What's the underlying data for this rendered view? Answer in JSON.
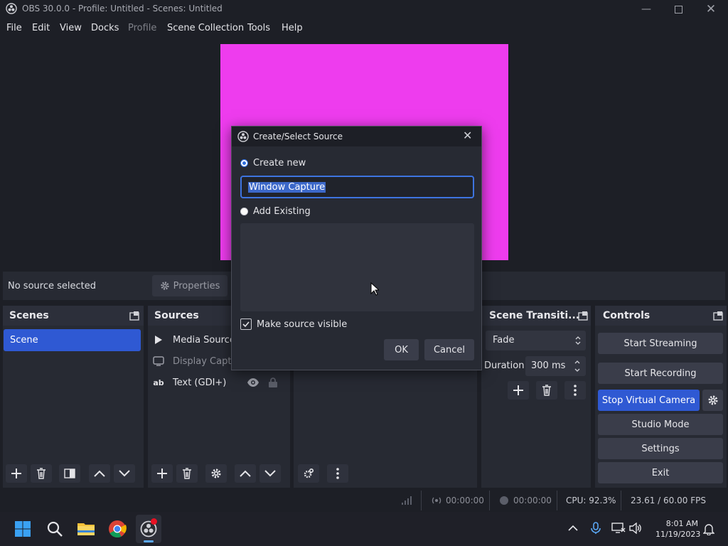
{
  "window": {
    "title": "OBS 30.0.0 - Profile: Untitled - Scenes: Untitled"
  },
  "menu": {
    "items": [
      "File",
      "Edit",
      "View",
      "Docks",
      "Profile",
      "Scene Collection",
      "Tools",
      "Help"
    ]
  },
  "source_toolbar": {
    "status": "No source selected",
    "properties_label": "Properties"
  },
  "scenes": {
    "title": "Scenes",
    "items": [
      "Scene"
    ]
  },
  "sources": {
    "title": "Sources",
    "items": [
      {
        "label": "Media Source",
        "icon": "play-icon"
      },
      {
        "label": "Display Captu",
        "icon": "monitor-icon"
      },
      {
        "label": "Text (GDI+)",
        "icon": "text-icon"
      }
    ]
  },
  "transitions": {
    "title": "Scene Transiti...",
    "selected": "Fade",
    "duration_label": "Duration",
    "duration_value": "300 ms"
  },
  "controls": {
    "title": "Controls",
    "buttons": [
      "Start Streaming",
      "Start Recording",
      "Stop Virtual Camera",
      "Studio Mode",
      "Settings",
      "Exit"
    ]
  },
  "status": {
    "stream_time": "00:00:00",
    "rec_time": "00:00:00",
    "cpu": "CPU: 92.3%",
    "fps": "23.61 / 60.00 FPS"
  },
  "taskbar": {
    "time": "8:01 AM",
    "date": "11/19/2023"
  },
  "dialog": {
    "title": "Create/Select Source",
    "create_new": "Create new",
    "name_value": "Window Capture",
    "add_existing": "Add Existing",
    "make_visible": "Make source visible",
    "ok": "OK",
    "cancel": "Cancel"
  },
  "colors": {
    "accent": "#2f59d3",
    "preview": "#ee3cee",
    "dock_bg": "#272a33"
  }
}
